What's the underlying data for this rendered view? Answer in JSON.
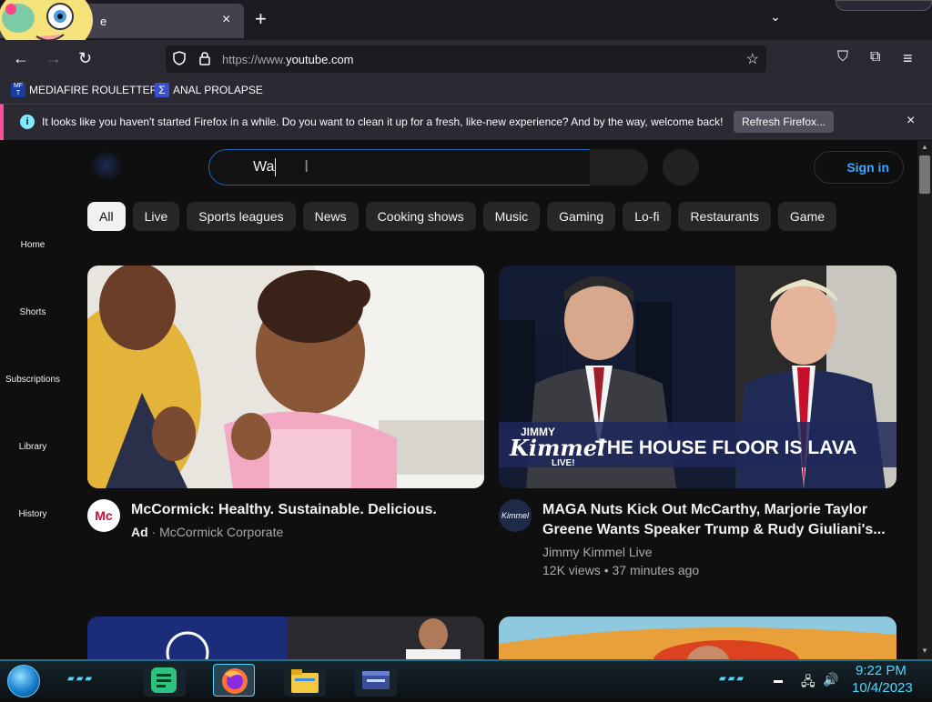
{
  "browser": {
    "tab_title": "e",
    "tab_close": "×",
    "new_tab": "+",
    "tab_list": "⌄",
    "nav": {
      "back": "←",
      "forward": "→",
      "reload": "↻"
    },
    "url_prefix": "https://www.",
    "url_domain": "youtube.com",
    "bookmark_icon": "☆",
    "toolbar": {
      "pocket": "⛉",
      "extensions": "⧉",
      "menu": "≡"
    },
    "bookmarks": [
      {
        "label": "MEDIAFIRE ROULETTER",
        "icon_text": "MF T"
      },
      {
        "label": "ANAL PROLAPSE",
        "icon_text": "Σ"
      }
    ],
    "notification": {
      "icon": "i",
      "text": "It looks like you haven't started Firefox in a while. Do you want to clean it up for a fresh, like-new experience? And by the way, welcome back!",
      "button": "Refresh Firefox...",
      "close": "×"
    }
  },
  "youtube": {
    "search_value": "Wa",
    "ibeam": "I",
    "signin": "Sign in",
    "chips": [
      "All",
      "Live",
      "Sports leagues",
      "News",
      "Cooking shows",
      "Music",
      "Gaming",
      "Lo-fi",
      "Restaurants",
      "Game"
    ],
    "sidebar": [
      "Home",
      "Shorts",
      "Subscriptions",
      "Library",
      "History"
    ],
    "videos": [
      {
        "title": "McCormick: Healthy. Sustainable. Delicious.",
        "badge": "Ad",
        "channel": "· McCormick Corporate",
        "avatar_text": "Mc"
      },
      {
        "title_line1": "MAGA Nuts Kick Out McCarthy, Marjorie Taylor",
        "title_line2": "Greene Wants Speaker Trump & Rudy Giuliani's...",
        "channel": "Jimmy Kimmel Live",
        "meta": "12K views • 37 minutes ago",
        "thumb_brand_top": "JIMMY",
        "thumb_brand": "Kimmel",
        "thumb_brand_live": "LIVE!",
        "thumb_caption": "THE HOUSE FLOOR IS LAVA",
        "avatar_text": "Kimmel"
      }
    ]
  },
  "taskbar": {
    "time": "9:22 PM",
    "date": "10/4/2023"
  }
}
